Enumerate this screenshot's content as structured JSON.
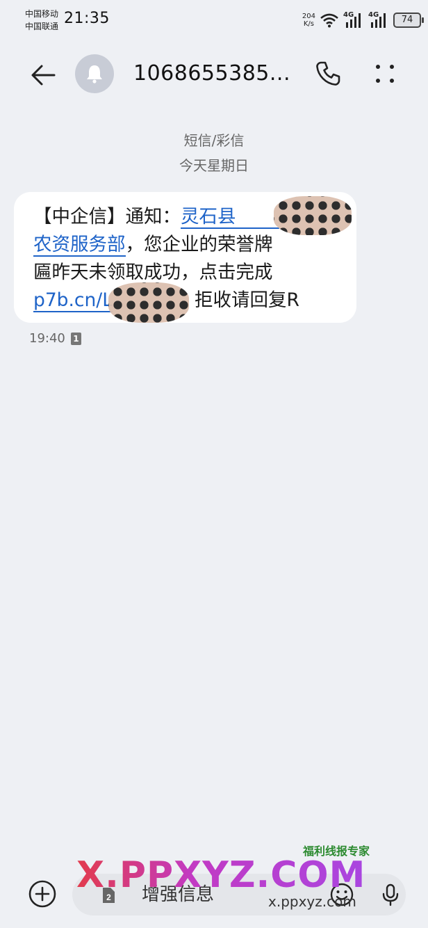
{
  "status_bar": {
    "carrier_1": "中国移动",
    "carrier_2": "中国联通",
    "time": "21:35",
    "net_speed_value": "204",
    "net_speed_unit": "K/s",
    "sig1_tag": "4G",
    "sig2_tag": "4G",
    "battery": "74"
  },
  "header": {
    "contact": "1068655385..."
  },
  "thread": {
    "type_label": "短信/彩信",
    "date_label": "今天星期日"
  },
  "message": {
    "l1_prefix": "【中企信】通知：",
    "l1_link": "灵石县",
    "l2_link": "农资服务部",
    "l2_rest": "，您企业的荣誉牌",
    "l3": "匾昨天未领取成功，点击完成",
    "l4_link": "p7b.cn/L",
    "l4_rest": "拒收请回复R",
    "time": "19:40",
    "sim": "1"
  },
  "composer": {
    "sim": "2",
    "placeholder": "增强信息"
  },
  "watermark": {
    "main": "X.PPXYZ.COM",
    "url": "x.ppxyz.com",
    "tag": "福利线报专家"
  },
  "colors": {
    "accent_link": "#1e63c8",
    "background": "#eef0f4",
    "bubble": "#ffffff"
  }
}
